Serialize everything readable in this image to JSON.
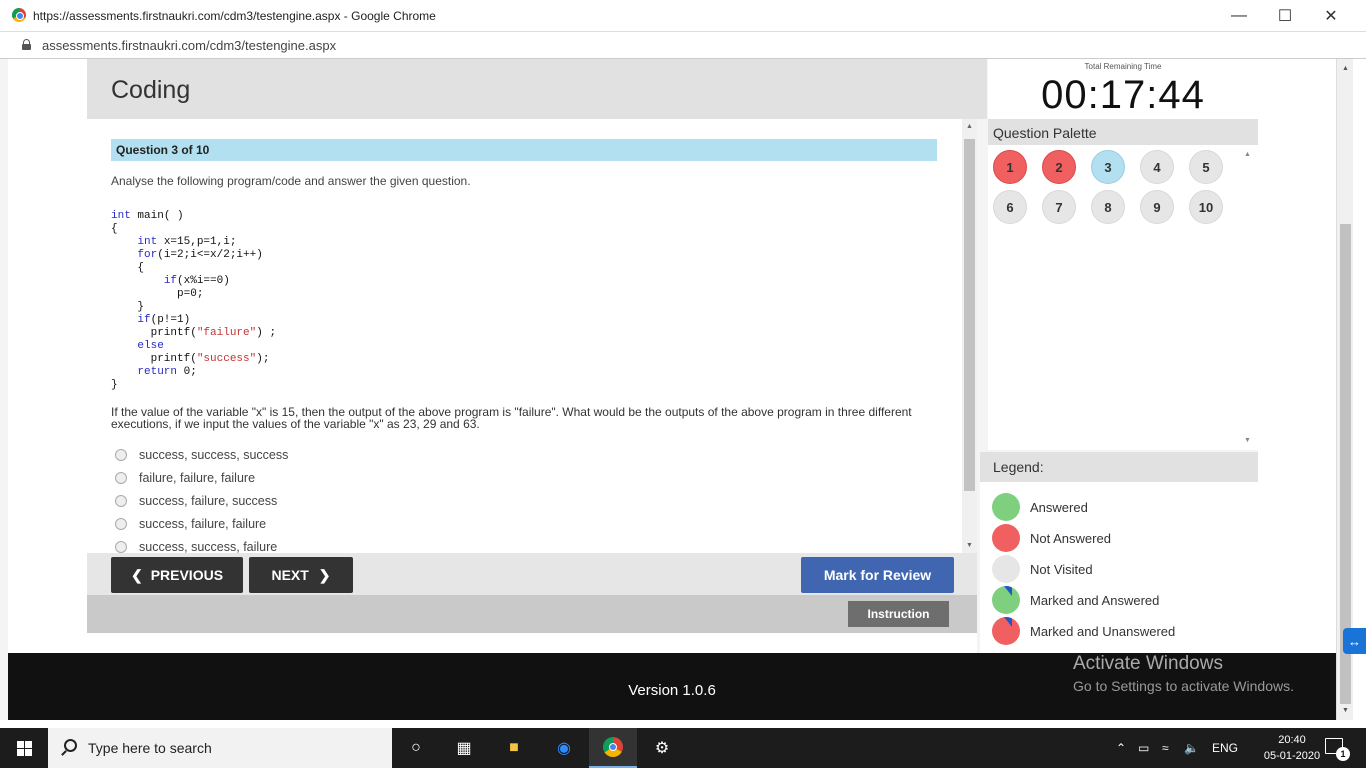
{
  "browser": {
    "window_title": "https://assessments.firstnaukri.com/cdm3/testengine.aspx - Google Chrome",
    "url": "assessments.firstnaukri.com/cdm3/testengine.aspx"
  },
  "header": {
    "section_title": "Coding",
    "timer_label": "Total Remaining Time",
    "timer_value": "00:17:44"
  },
  "question": {
    "counter": "Question 3 of 10",
    "instruction": "Analyse the following program/code and answer the given question.",
    "text": "If the value of the variable \"x\" is 15, then the output of the above program is \"failure\". What would be the outputs of the above program in three different executions, if we input the values of the variable \"x\" as 23, 29 and 63.",
    "code_lines": [
      [
        {
          "t": "int",
          "k": "kw"
        },
        {
          "t": " main( )"
        }
      ],
      [
        {
          "t": "{"
        }
      ],
      [
        {
          "t": "    "
        },
        {
          "t": "int",
          "k": "kw"
        },
        {
          "t": " x=15,p=1,i;"
        }
      ],
      [
        {
          "t": "    "
        },
        {
          "t": "for",
          "k": "kw"
        },
        {
          "t": "(i=2;i<=x/2;i++)"
        }
      ],
      [
        {
          "t": "    {"
        }
      ],
      [
        {
          "t": "        "
        },
        {
          "t": "if",
          "k": "kw"
        },
        {
          "t": "(x%i==0)"
        }
      ],
      [
        {
          "t": "          p=0;"
        }
      ],
      [
        {
          "t": "    }"
        }
      ],
      [
        {
          "t": "    "
        },
        {
          "t": "if",
          "k": "kw"
        },
        {
          "t": "(p!=1)"
        }
      ],
      [
        {
          "t": "      printf("
        },
        {
          "t": "\"failure\"",
          "k": "str"
        },
        {
          "t": ") ;"
        }
      ],
      [
        {
          "t": "    "
        },
        {
          "t": "else",
          "k": "kw"
        }
      ],
      [
        {
          "t": "      printf("
        },
        {
          "t": "\"success\"",
          "k": "str"
        },
        {
          "t": ");"
        }
      ],
      [
        {
          "t": "    "
        },
        {
          "t": "return",
          "k": "kw"
        },
        {
          "t": " 0;"
        }
      ],
      [
        {
          "t": "}"
        }
      ]
    ],
    "options": [
      "success, success, success",
      "failure, failure, failure",
      "success, failure, success",
      "success, failure, failure",
      "success, success, failure"
    ]
  },
  "nav": {
    "previous_label": "PREVIOUS",
    "next_label": "NEXT",
    "mark_review_label": "Mark for Review",
    "instruction_label": "Instruction"
  },
  "palette": {
    "title": "Question Palette",
    "items": [
      {
        "num": "1",
        "status": "not-answered"
      },
      {
        "num": "2",
        "status": "not-answered"
      },
      {
        "num": "3",
        "status": "current"
      },
      {
        "num": "4",
        "status": "not-visited"
      },
      {
        "num": "5",
        "status": "not-visited"
      },
      {
        "num": "6",
        "status": "not-visited"
      },
      {
        "num": "7",
        "status": "not-visited"
      },
      {
        "num": "8",
        "status": "not-visited"
      },
      {
        "num": "9",
        "status": "not-visited"
      },
      {
        "num": "10",
        "status": "not-visited"
      }
    ]
  },
  "legend": {
    "title": "Legend:",
    "items": [
      {
        "label": "Answered",
        "color": "#7ed07e",
        "flag": false
      },
      {
        "label": "Not Answered",
        "color": "#f06060",
        "flag": false
      },
      {
        "label": "Not Visited",
        "color": "#e6e6e6",
        "flag": false
      },
      {
        "label": "Marked and Answered",
        "color": "#7ed07e",
        "flag": true
      },
      {
        "label": "Marked and Unanswered",
        "color": "#f06060",
        "flag": true
      }
    ]
  },
  "footer": {
    "version": "Version 1.0.6",
    "activate_title": "Activate Windows",
    "activate_sub": "Go to Settings to activate Windows."
  },
  "taskbar": {
    "search_placeholder": "Type here to search",
    "language": "ENG",
    "time": "20:40",
    "date": "05-01-2020",
    "notification_count": "1"
  },
  "colors": {
    "question_bar": "#b2e0f0",
    "mark_review": "#4066b1",
    "not_answered": "#f06060",
    "answered": "#7ed07e"
  }
}
